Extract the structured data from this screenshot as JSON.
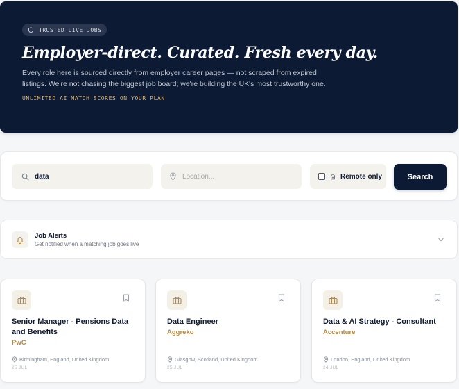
{
  "hero": {
    "badge": "TRUSTED LIVE JOBS",
    "title": "Employer-direct. Curated. Fresh every day.",
    "description": "Every role here is sourced directly from employer career pages — not scraped from expired listings. We're not chasing the biggest job board; we're building the UK's most trustworthy one.",
    "note": "UNLIMITED AI MATCH SCORES ON YOUR PLAN"
  },
  "search": {
    "query_value": "data",
    "location_placeholder": "Location...",
    "remote_label": "Remote only",
    "button_label": "Search"
  },
  "alerts": {
    "title": "Job Alerts",
    "subtitle": "Get notified when a matching job goes live"
  },
  "jobs": [
    {
      "title": "Senior Manager - Pensions Data and Benefits",
      "company": "PwC",
      "location": "Birmingham, England, United Kingdom",
      "date": "25 JUL"
    },
    {
      "title": "Data Engineer",
      "company": "Aggreko",
      "location": "Glasgow, Scotland, United Kingdom",
      "date": "25 JUL"
    },
    {
      "title": "Data & AI Strategy - Consultant",
      "company": "Accenture",
      "location": "London, England, United Kingdom",
      "date": "24 JUL"
    }
  ],
  "colors": {
    "navy": "#0c1a33",
    "accent_gold": "#b08a4e",
    "field_bg": "#f4f2ec"
  },
  "icons": [
    "shield-icon",
    "search-icon",
    "location-pin-icon",
    "home-icon",
    "bell-icon",
    "chevron-down-icon",
    "briefcase-icon",
    "bookmark-icon"
  ]
}
